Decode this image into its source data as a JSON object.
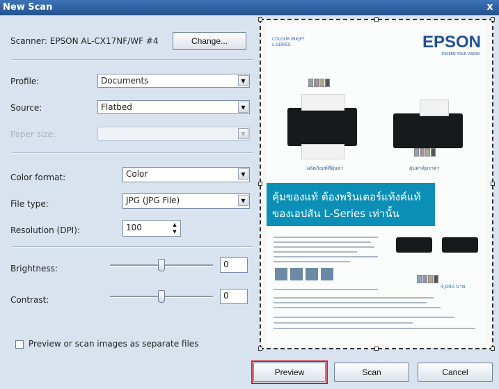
{
  "window": {
    "title": "New Scan",
    "close_glyph": "x"
  },
  "scanner": {
    "label": "Scanner: EPSON AL-CX17NF/WF #4",
    "change_button": "Change..."
  },
  "profile": {
    "label": "Profile:",
    "value": "Documents"
  },
  "source": {
    "label": "Source:",
    "value": "Flatbed"
  },
  "paper_size": {
    "label": "Paper size:",
    "value": ""
  },
  "color_format": {
    "label": "Color format:",
    "value": "Color"
  },
  "file_type": {
    "label": "File type:",
    "value": "JPG (JPG File)"
  },
  "resolution": {
    "label": "Resolution (DPI):",
    "value": "100"
  },
  "brightness": {
    "label": "Brightness:",
    "value": "0",
    "level": 0.5
  },
  "contrast": {
    "label": "Contrast:",
    "value": "0",
    "level": 0.5
  },
  "separate_files": {
    "label": "Preview or scan images as separate files",
    "checked": false
  },
  "preview_doc": {
    "series_top": "COLOUR INKJET",
    "series_bottom": "L-SERIES",
    "brand": "EPSON",
    "tagline": "EXCEED YOUR VISION",
    "banner_line1": "คุ้มของแท้ ต้องพรินเตอร์แท้งค์แท้",
    "banner_line2": "ของเอปสัน L-Series เท่านั้น",
    "caption_left": "ผลิตภัณฑ์ที่คุ้มค่า",
    "caption_right": "คุ้มค่าคุ้มราคา",
    "price_text": "4,000 บาท"
  },
  "buttons": {
    "preview": "Preview",
    "scan": "Scan",
    "cancel": "Cancel"
  },
  "colors": {
    "title_bar": "#2b5c9d",
    "highlight": "#d21c25",
    "banner": "#0b8fb6",
    "brand": "#1f4f9b"
  }
}
